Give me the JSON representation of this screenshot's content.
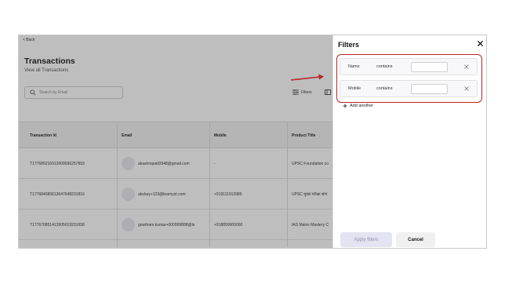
{
  "header": {
    "back_label": "< Back",
    "title": "Transactions",
    "subtitle": "View all Transactions"
  },
  "search": {
    "placeholder": "Search by Email"
  },
  "toolbar": {
    "filters_label": "Filters"
  },
  "table": {
    "columns": [
      "Transaction Id",
      "Email",
      "Mobile",
      "Product Title"
    ],
    "rows": [
      [
        "T1776852169139095962578​93",
        "akashmpatil3948@gmail.com",
        "-",
        "UPSC Foundation co"
      ],
      [
        "T177684089613647648231816",
        "akshay+123@learnyst.com",
        "+919111913985",
        "UPSC मुख्य परीक्षा श्रेण"
      ],
      [
        "T177676851413905019231658",
        "gowtham.kumar+000999888@le",
        "+918899000000",
        "IAS Mains Mastery C"
      ]
    ]
  },
  "filters_panel": {
    "title": "Filters",
    "rows": [
      {
        "field": "Name",
        "operator": "contains",
        "value": ""
      },
      {
        "field": "Mobile",
        "operator": "contains",
        "value": ""
      }
    ],
    "add_another_label": "Add another",
    "apply_label": "Apply filters",
    "cancel_label": "Cancel"
  },
  "colors": {
    "highlight": "#b82525",
    "apply_bg": "#e3e3f2",
    "apply_text": "#8f8fae"
  }
}
